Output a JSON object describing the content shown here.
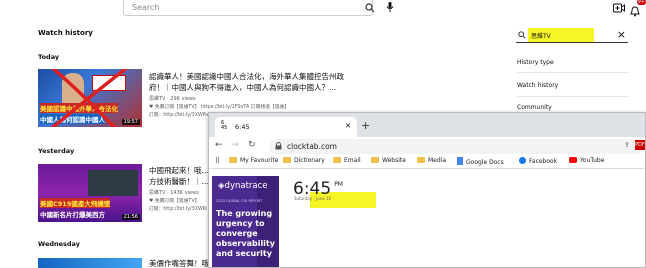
{
  "header": {
    "search_placeholder": "Search",
    "notification_count": "9+"
  },
  "page": {
    "title": "Watch history",
    "sections": [
      "Today",
      "Yesterday",
      "Wednesday"
    ]
  },
  "videos": [
    {
      "title_line1": "認識華人！美國認識中國人合法化，海外華人集體控告州政",
      "title_line2": "府！｜中國人與狗不得進入，中國人為何認識中國人？...",
      "channel": "思維TV",
      "views": "29K views",
      "desc1": "♥ 免費訂閱【思維TV】   https://bit.ly/2FSoTA 訂閱頻道【思維】",
      "desc2": "訂閱：http://bit.ly/3XWRsLM 歡迎觀看",
      "duration": "19:57",
      "thumb_text1": "美國認識中海外華人合法化",
      "thumb_text2": "中國人為何認識中國人"
    },
    {
      "title_line1": "中國飛起來！哦…",
      "title_line2": "方技術醫斷！｜…",
      "channel": "思維TV",
      "views": "143K views",
      "desc1": "♥ 免費訂閱【思維TV】",
      "desc2": "訂閱：http://bit.ly/3XWRsLM 歡迎",
      "duration": "21:56",
      "thumb_text1": "美國C919國產大飛機墜",
      "thumb_text2": "中國新名片打爆美西方"
    },
    {
      "title_line1": "美價作嘴答舞！哦…",
      "title_line2": "",
      "channel": "",
      "views": "",
      "desc1": "",
      "desc2": "",
      "duration": "",
      "thumb_text1": "",
      "thumb_text2": ""
    }
  ],
  "sidebar": {
    "search_value": "思維TV",
    "links": [
      "History type",
      "Watch history",
      "Community"
    ]
  },
  "browser": {
    "tab_label": "6:45",
    "tab_icon_text": "6\n45",
    "url": "clocktab.com",
    "bookmarks": [
      "My Favourite",
      "Dictionary",
      "Email",
      "Website",
      "Media",
      "Google Docs",
      "Facebook",
      "YouTube"
    ],
    "ad_logo": "dynatrace",
    "ad_sub": "2023 GLOBAL CIO REPORT",
    "ad_headline": "The growing urgency to converge observability and security",
    "clock_time": "6:45",
    "clock_ampm": "PM",
    "clock_date": "Saturday - June 10"
  },
  "colors": {
    "highlight": "#f5f500",
    "ad_bg": "#4b2a8f",
    "youtube_red": "#ff0000"
  }
}
